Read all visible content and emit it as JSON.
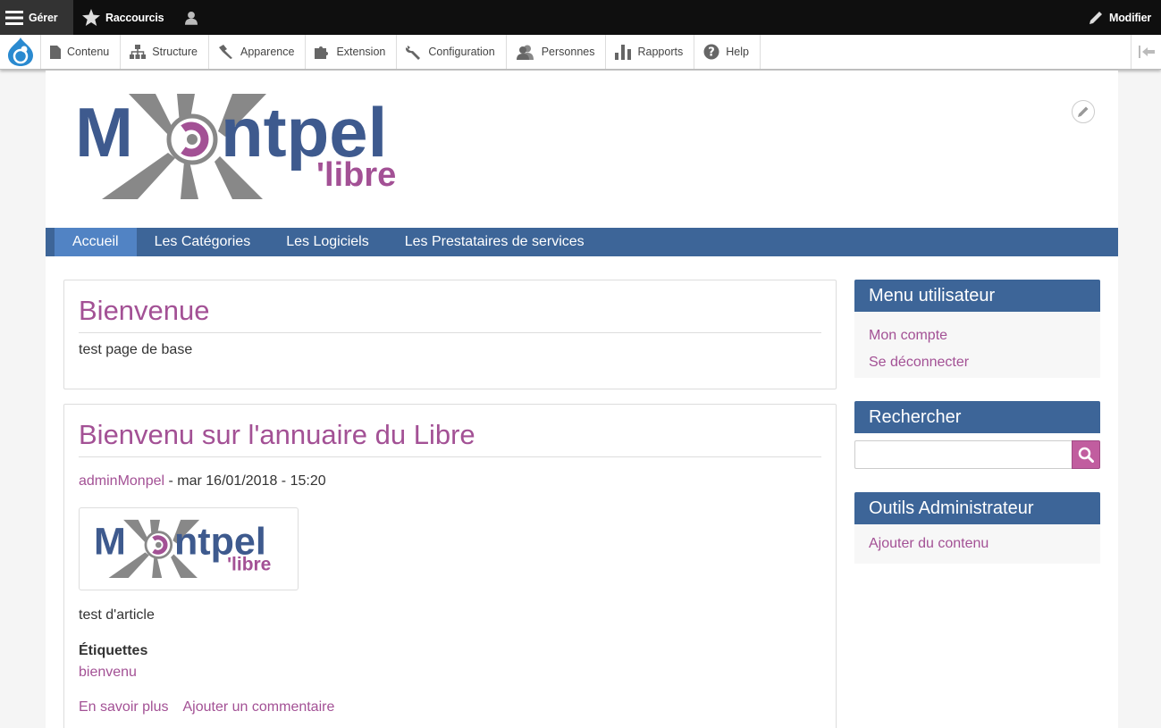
{
  "admin_bar": {
    "manage_label": "Gérer",
    "shortcuts_label": "Raccourcis",
    "edit_label": "Modifier"
  },
  "toolbar": {
    "items": [
      {
        "label": "Contenu",
        "icon": "file-icon"
      },
      {
        "label": "Structure",
        "icon": "sitemap-icon"
      },
      {
        "label": "Apparence",
        "icon": "brush-icon"
      },
      {
        "label": "Extension",
        "icon": "puzzle-icon"
      },
      {
        "label": "Configuration",
        "icon": "wrench-icon"
      },
      {
        "label": "Personnes",
        "icon": "people-icon"
      },
      {
        "label": "Rapports",
        "icon": "bar-chart-icon"
      },
      {
        "label": "Help",
        "icon": "help-icon"
      }
    ]
  },
  "logo": {
    "name_part1": "M",
    "name_part2": "ntpel",
    "tagline": "'libre"
  },
  "nav": {
    "items": [
      "Accueil",
      "Les Catégories",
      "Les Logiciels",
      "Les Prestataires de services"
    ],
    "active_index": 0
  },
  "main": {
    "card1": {
      "title": "Bienvenue",
      "body": "test page de base"
    },
    "card2": {
      "title": "Bienvenu sur l'annuaire du Libre",
      "author": "adminMonpel",
      "date": " - mar 16/01/2018 - 15:20",
      "body": "test d'article",
      "tags_label": "Étiquettes",
      "tag": "bienvenu",
      "read_more": "En savoir plus",
      "add_comment": "Ajouter un commentaire"
    }
  },
  "sidebar": {
    "user_menu": {
      "title": "Menu utilisateur",
      "links": [
        "Mon compte",
        "Se déconnecter"
      ]
    },
    "search": {
      "title": "Rechercher",
      "placeholder": "",
      "value": ""
    },
    "admin_tools": {
      "title": "Outils Administrateur",
      "links": [
        "Ajouter du contenu"
      ]
    }
  },
  "colors": {
    "brand_blue": "#3d6598",
    "nav_active": "#5183c4",
    "link_purple": "#a35195",
    "search_button": "#c15d9f"
  }
}
